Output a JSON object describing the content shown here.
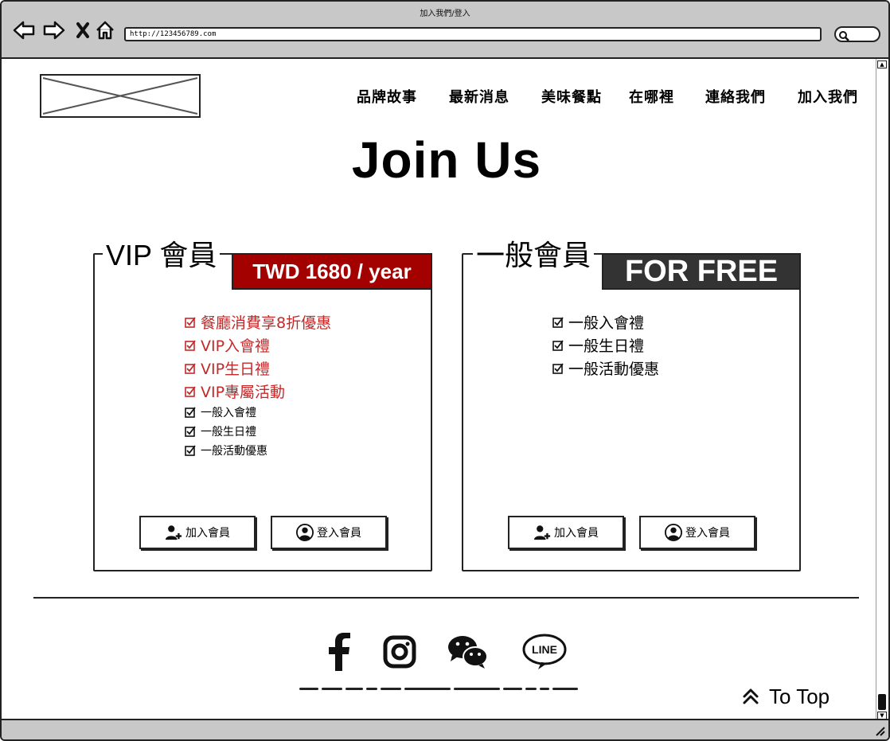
{
  "window": {
    "title": "加入我們/登入",
    "url": "http://123456789.com"
  },
  "nav": {
    "items": [
      {
        "label": "品牌故事"
      },
      {
        "label": "最新消息"
      },
      {
        "label": "美味餐點"
      },
      {
        "label": "在哪裡"
      },
      {
        "label": "連絡我們"
      },
      {
        "label": "加入我們"
      }
    ]
  },
  "page": {
    "title": "Join Us"
  },
  "vip_card": {
    "heading": "VIP 會員",
    "price": "TWD 1680 / year",
    "price_color": "#a30000",
    "highlight_color": "#c62828",
    "highlights": [
      "餐廳消費享8折優惠",
      "VIP入會禮",
      "VIP生日禮",
      "VIP專屬活動"
    ],
    "benefits": [
      "一般入會禮",
      "一般生日禮",
      "一般活動優惠"
    ],
    "join_label": "加入會員",
    "login_label": "登入會員"
  },
  "free_card": {
    "heading": "一般會員",
    "price": "FOR FREE",
    "price_color": "#333333",
    "benefits": [
      "一般入會禮",
      "一般生日禮",
      "一般活動優惠"
    ],
    "join_label": "加入會員",
    "login_label": "登入會員"
  },
  "footer": {
    "social": [
      "facebook-icon",
      "instagram-icon",
      "wechat-icon",
      "line-icon"
    ],
    "line_label": "LINE",
    "to_top_label": "To Top"
  }
}
